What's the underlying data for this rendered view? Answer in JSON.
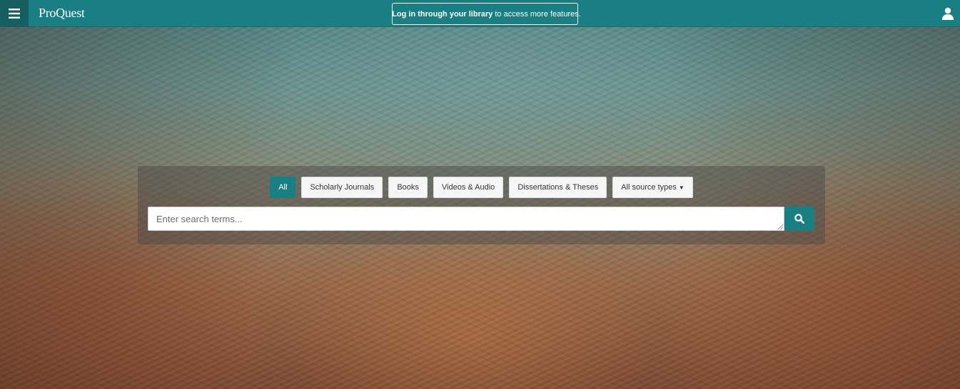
{
  "header": {
    "brand": "ProQuest",
    "login_bold": "Log in through your library",
    "login_rest": "to access more features."
  },
  "icons": {
    "menu": "hamburger-menu-icon",
    "library": "institution-icon",
    "user": "user-icon",
    "search": "magnifier-icon"
  },
  "filters": [
    {
      "label": "All",
      "active": true
    },
    {
      "label": "Scholarly Journals",
      "active": false
    },
    {
      "label": "Books",
      "active": false
    },
    {
      "label": "Videos & Audio",
      "active": false
    },
    {
      "label": "Dissertations & Theses",
      "active": false
    },
    {
      "label": "All source types",
      "active": false
    }
  ],
  "search": {
    "placeholder": "Enter search terms...",
    "value": ""
  },
  "colors": {
    "accent": "#1a7f82",
    "topbar": "#1a7f82",
    "menu_bg": "#155f62"
  }
}
